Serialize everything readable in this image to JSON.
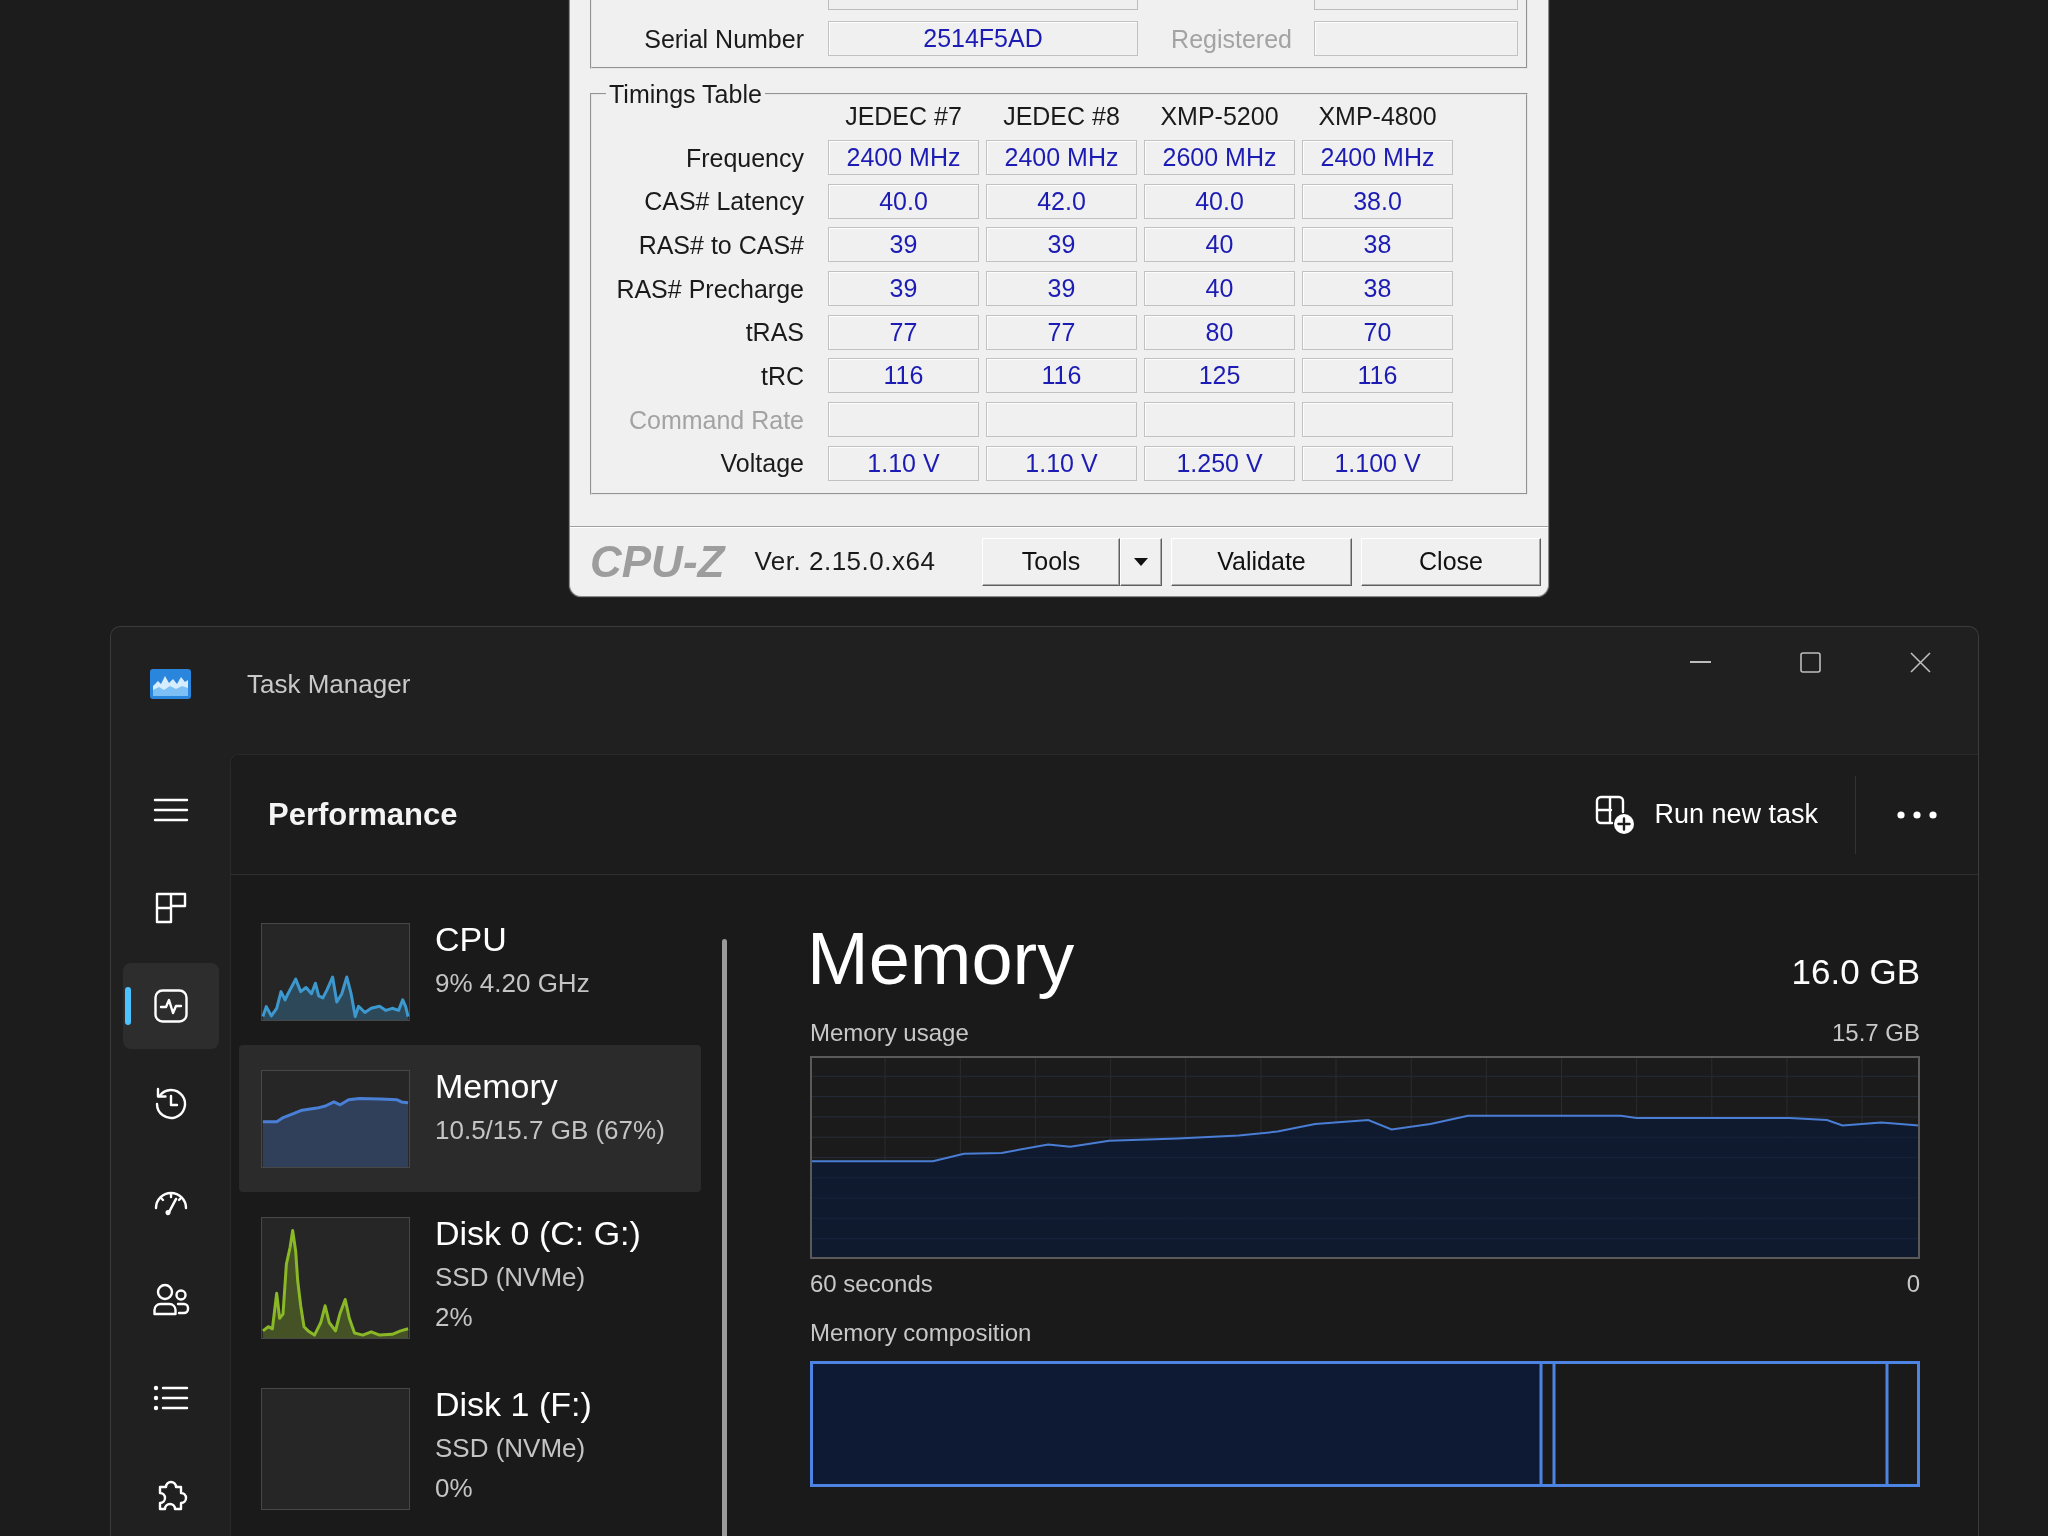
{
  "cpuz": {
    "module": {
      "rows": [
        {
          "label": "Serial Number",
          "value": "2514F5AD",
          "side": {
            "label": "Registered",
            "disabled": true
          }
        }
      ]
    },
    "timings_table": {
      "title": "Timings Table",
      "columns": [
        "JEDEC #7",
        "JEDEC #8",
        "XMP-5200",
        "XMP-4800"
      ],
      "rows": [
        {
          "label": "Frequency",
          "disabled": false,
          "values": [
            "2400 MHz",
            "2400 MHz",
            "2600 MHz",
            "2400 MHz"
          ]
        },
        {
          "label": "CAS# Latency",
          "disabled": false,
          "values": [
            "40.0",
            "42.0",
            "40.0",
            "38.0"
          ]
        },
        {
          "label": "RAS# to CAS#",
          "disabled": false,
          "values": [
            "39",
            "39",
            "40",
            "38"
          ]
        },
        {
          "label": "RAS# Precharge",
          "disabled": false,
          "values": [
            "39",
            "39",
            "40",
            "38"
          ]
        },
        {
          "label": "tRAS",
          "disabled": false,
          "values": [
            "77",
            "77",
            "80",
            "70"
          ]
        },
        {
          "label": "tRC",
          "disabled": false,
          "values": [
            "116",
            "116",
            "125",
            "116"
          ]
        },
        {
          "label": "Command Rate",
          "disabled": true
        },
        {
          "label": "Voltage",
          "disabled": false,
          "values": [
            "1.10 V",
            "1.10 V",
            "1.250 V",
            "1.100 V"
          ]
        }
      ]
    },
    "footer": {
      "logo": "CPU-Z",
      "version": "Ver. 2.15.0.x64",
      "buttons": [
        {
          "label": "Tools",
          "kind": "split"
        },
        {
          "label": "Validate",
          "kind": "push"
        },
        {
          "label": "Close",
          "kind": "push"
        }
      ]
    }
  },
  "task_manager": {
    "window": {
      "title": "Task Manager"
    },
    "nav": {
      "items": [
        {
          "selected": false
        },
        {
          "selected": true
        },
        {
          "selected": false
        },
        {
          "selected": false
        },
        {
          "selected": false
        },
        {
          "selected": false
        },
        {
          "selected": false
        }
      ]
    },
    "header": {
      "title": "Performance",
      "actions": [
        {
          "label": "Run new task"
        }
      ]
    },
    "resources": [
      {
        "name": "CPU",
        "details": [
          "9% 4.20 GHz"
        ],
        "selected": false,
        "color": "#3c98cf"
      },
      {
        "name": "Memory",
        "details": [
          "10.5/15.7 GB (67%)"
        ],
        "selected": true,
        "color": "#4a7fd6"
      },
      {
        "name": "Disk 0 (C: G:)",
        "details": [
          "SSD (NVMe)",
          "2%"
        ],
        "selected": false,
        "color": "#8ab827"
      },
      {
        "name": "Disk 1 (F:)",
        "details": [
          "SSD (NVMe)",
          "0%"
        ],
        "selected": false
      }
    ],
    "detail": {
      "title": "Memory",
      "capacity": "16.0 GB",
      "usage_graph": {
        "label": "Memory usage",
        "max_label": "15.7 GB",
        "start_label": "60 seconds",
        "end_label": "0"
      },
      "composition": {
        "label": "Memory composition"
      }
    }
  }
}
